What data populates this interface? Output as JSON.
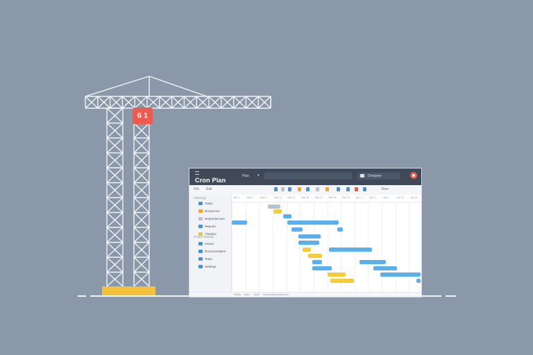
{
  "crane": {
    "sign_text": "6 1",
    "sign_color": "#ef5a4c",
    "base_color": "#f2c33a"
  },
  "app": {
    "name": "Cron Plan",
    "project": "Plan",
    "user": "Designer"
  },
  "toolbar": {
    "items": [
      "File",
      "Edit",
      "View",
      "Tasks",
      "Resources",
      "Reports"
    ]
  },
  "sidebar": {
    "section_1": "Planning",
    "items_1": [
      {
        "label": "Tasks",
        "color": "#4a90d9"
      },
      {
        "label": "Resources",
        "color": "#f2a33a"
      },
      {
        "label": "Dependencies",
        "color": "#b9c2cd"
      },
      {
        "label": "Reports",
        "color": "#4a90d9"
      },
      {
        "label": "Timeline",
        "color": "#f2c33a"
      }
    ],
    "section_2": "Project Details",
    "items_2": [
      {
        "label": "Issues",
        "color": "#4a90d9"
      },
      {
        "label": "Documentation",
        "color": "#4a90d9"
      },
      {
        "label": "Team",
        "color": "#4a90d9"
      },
      {
        "label": "Settings",
        "color": "#4a90d9"
      }
    ]
  },
  "timeline": {
    "columns": [
      "Mar 1",
      "Mar 4",
      "Mar 8",
      "Mar 11",
      "Mar 15",
      "Mar 18",
      "Mar 22",
      "Mar 25",
      "Mar 29",
      "Apr 1",
      "Apr 5",
      "Apr 8",
      "Apr 12",
      "Apr 15"
    ]
  },
  "statusbar": {
    "items": [
      "Ready",
      "Tasks",
      "Gantt",
      "Summary",
      "Calendar",
      "Zoom"
    ]
  },
  "colors": {
    "background": "#8a98a9",
    "titlebar": "#3f4957",
    "bar_blue": "#5ab0ea",
    "bar_yellow": "#f5cb3a",
    "bar_grey": "#b9c2cd"
  }
}
